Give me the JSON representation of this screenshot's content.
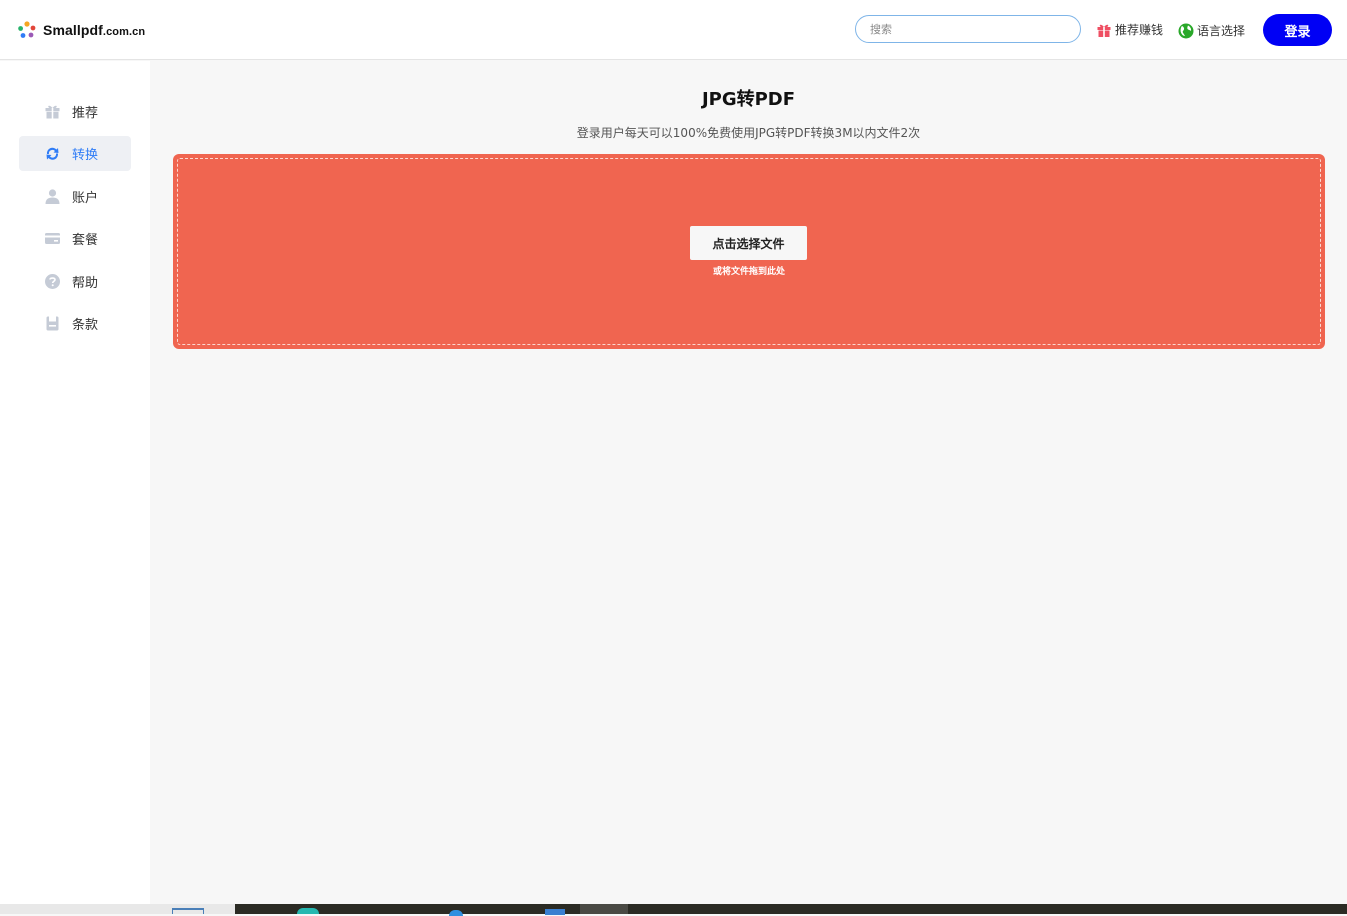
{
  "header": {
    "logo_text": "Smallpdf",
    "logo_suffix": ".com.cn",
    "search_placeholder": "搜索",
    "referral_label": "推荐赚钱",
    "language_label": "语言选择",
    "login_label": "登录"
  },
  "sidebar": {
    "items": [
      {
        "label": "推荐",
        "icon": "gift-icon"
      },
      {
        "label": "转换",
        "icon": "convert-icon",
        "active": true
      },
      {
        "label": "账户",
        "icon": "user-icon"
      },
      {
        "label": "套餐",
        "icon": "card-icon"
      },
      {
        "label": "帮助",
        "icon": "help-icon"
      },
      {
        "label": "条款",
        "icon": "document-icon"
      }
    ]
  },
  "main": {
    "title": "JPG转PDF",
    "subtitle": "登录用户每天可以100%免费使用JPG转PDF转换3M以内文件2次",
    "choose_button": "点击选择文件",
    "drag_hint": "或将文件拖到此处"
  },
  "colors": {
    "accent": "#0000f5",
    "dropzone": "#f06550",
    "active_nav": "#2f7cf6"
  }
}
